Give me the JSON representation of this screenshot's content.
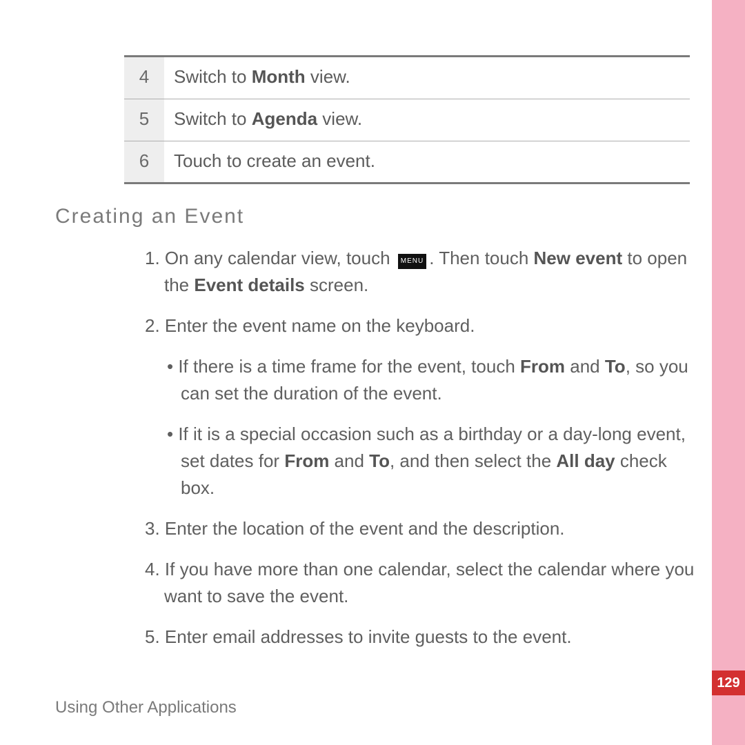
{
  "legend": [
    {
      "num": "4",
      "text_pre": "Switch to ",
      "bold": "Month",
      "text_post": " view."
    },
    {
      "num": "5",
      "text_pre": "Switch to ",
      "bold": "Agenda",
      "text_post": " view."
    },
    {
      "num": "6",
      "text_pre": "Touch to create an event.",
      "bold": "",
      "text_post": ""
    }
  ],
  "heading": "Creating  an  Event",
  "step1_pre": "1. On any calendar view, touch ",
  "menu_label": "MENU",
  "step1_mid": ". Then touch ",
  "step1_b1": "New event",
  "step1_mid2": " to open the ",
  "step1_b2": "Event details",
  "step1_post": " screen.",
  "step2": "2. Enter the event name on the keyboard.",
  "bullet1_pre": "• If there is a time frame for the event, touch ",
  "bullet1_b1": "From",
  "bullet1_mid": " and ",
  "bullet1_b2": "To",
  "bullet1_post": ", so you can set the duration of the event.",
  "bullet2_pre": "• If it is a special occasion such as a birthday or a day-long event, set dates for ",
  "bullet2_b1": "From",
  "bullet2_mid": " and ",
  "bullet2_b2": "To",
  "bullet2_mid2": ", and then select the ",
  "bullet2_b3": "All day",
  "bullet2_post": " check box.",
  "step3": "3. Enter the location of the event and the description.",
  "step4": "4. If you have more than one calendar, select the calendar where you want to save the event.",
  "step5": "5. Enter email addresses to invite guests to the event.",
  "footer": "Using Other Applications",
  "page_number": "129"
}
